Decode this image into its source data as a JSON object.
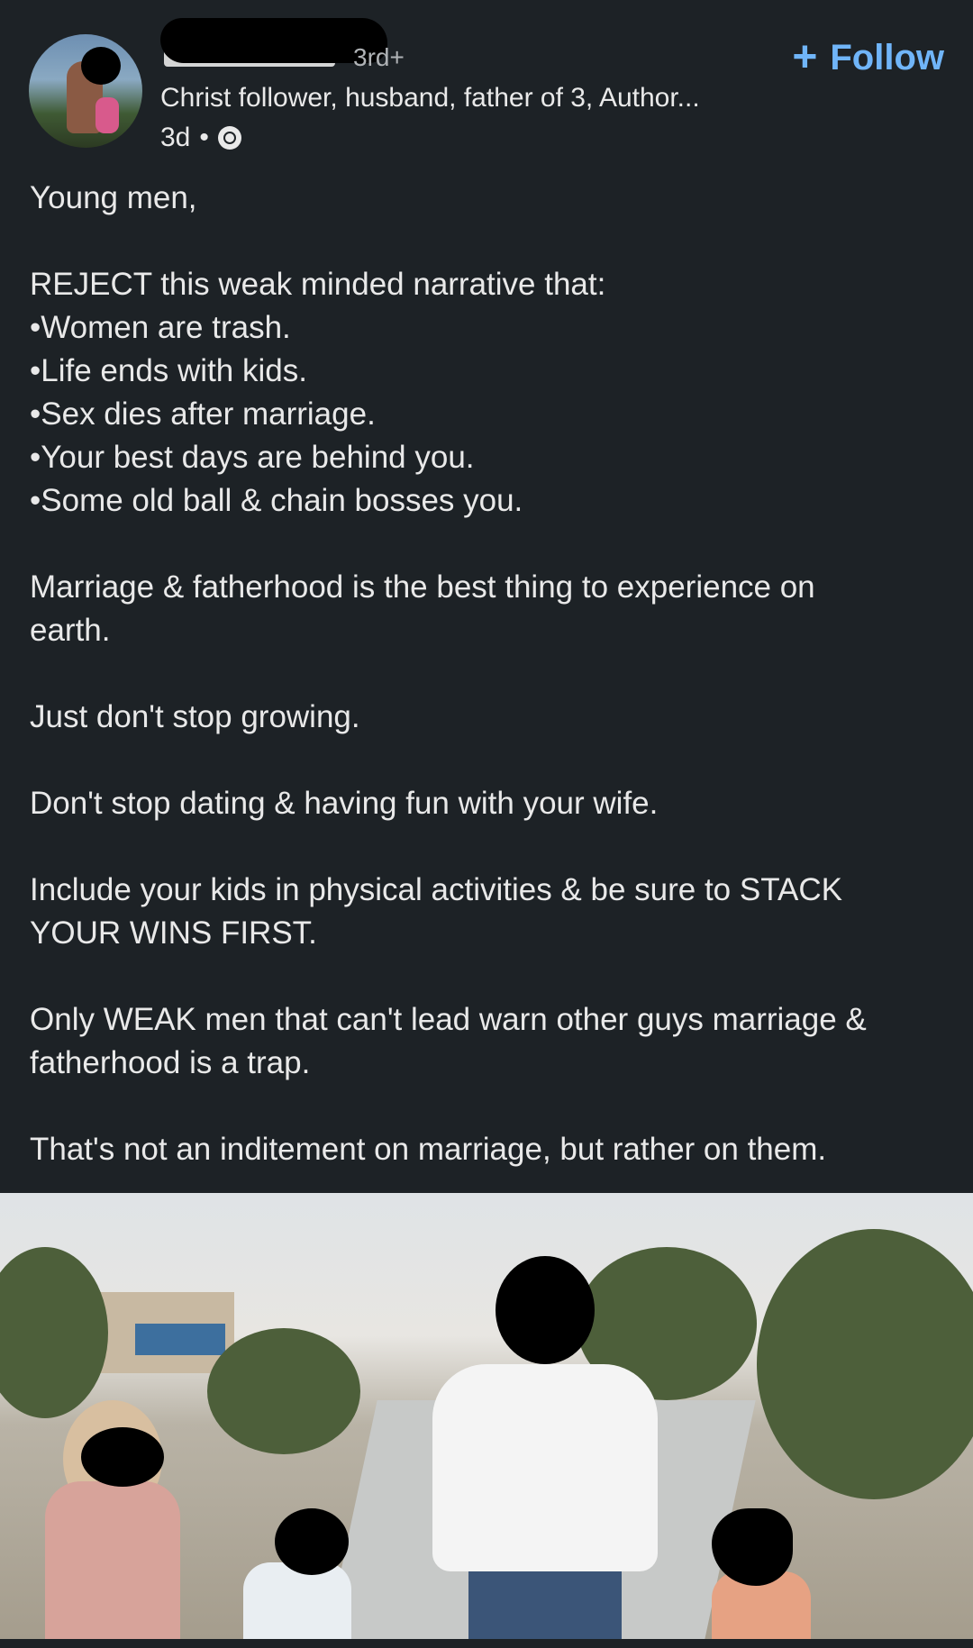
{
  "author": {
    "degree": "3rd+",
    "headline": "Christ follower, husband, father of 3, Author...",
    "time": "3d",
    "visibility_icon": "globe-icon"
  },
  "follow_label": "Follow",
  "post_lines": [
    "Young men,",
    "",
    "REJECT this weak minded narrative that:",
    "•Women are trash.",
    "•Life ends with kids.",
    "•Sex dies after marriage.",
    "•Your best days are behind you.",
    "•Some old ball & chain bosses you.",
    "",
    "Marriage & fatherhood is the best thing to experience on",
    "earth.",
    "",
    "Just don't stop growing.",
    "",
    "Don't stop dating & having fun with your wife.",
    "",
    "Include your kids in physical activities & be sure to STACK",
    "YOUR WINS FIRST.",
    "",
    "Only WEAK men that can't lead warn other guys marriage &",
    "fatherhood is a trap.",
    "",
    "That's not an inditement on marriage, but rather on them."
  ],
  "colors": {
    "background": "#1d2226",
    "text": "#e9e9e9",
    "follow": "#70b5f9"
  }
}
